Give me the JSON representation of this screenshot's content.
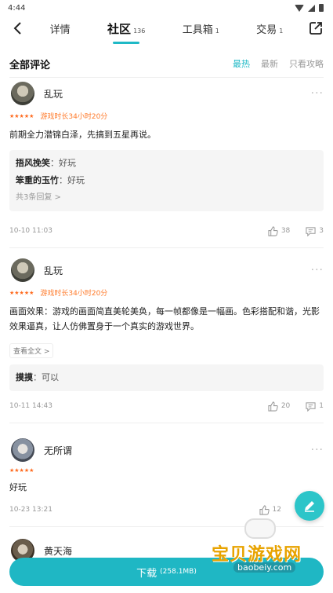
{
  "status_bar": {
    "time": "4:44"
  },
  "nav": {
    "tabs": [
      {
        "label": "详情",
        "count": ""
      },
      {
        "label": "社区",
        "count": "136"
      },
      {
        "label": "工具箱",
        "count": "1"
      },
      {
        "label": "交易",
        "count": "1"
      }
    ],
    "active_tab": "社区"
  },
  "section": {
    "title": "全部评论",
    "sorts": [
      "最热",
      "最新",
      "只看攻略"
    ],
    "active_sort": "最热"
  },
  "comments": [
    {
      "user": "乱玩",
      "stars": "★★★★★",
      "play_time": "游戏时长34小时20分",
      "text": "前期全力潜锦白泽，先搞到五星再说。",
      "replies": [
        {
          "name": "捂风挽笑",
          "text": "好玩"
        },
        {
          "name": "笨重的玉竹",
          "text": "好玩"
        }
      ],
      "reply_more": "共3条回复 >",
      "date": "10-10 11:03",
      "likes": "38",
      "reply_count": "3"
    },
    {
      "user": "乱玩",
      "stars": "★★★★★",
      "play_time": "游戏时长34小时20分",
      "text": "画面效果：游戏的画面简直美轮美奂，每一帧都像是一幅画。色彩搭配和谐，光影效果逼真，让人仿佛置身于一个真实的游戏世界。",
      "expand": "查看全文 >",
      "replies": [
        {
          "name": "摸摸",
          "text": "可以"
        }
      ],
      "date": "10-11 14:43",
      "likes": "20",
      "reply_count": "1"
    },
    {
      "user": "无所谓",
      "stars": "★★★★★",
      "text": "好玩",
      "date": "10-23 13:21",
      "likes": "12"
    },
    {
      "user": "黄天海"
    }
  ],
  "download": {
    "label": "下载",
    "size": "(258.1MB)"
  },
  "watermark": {
    "text": "宝贝游戏网",
    "url": "baobeiy.com"
  },
  "colors": {
    "accent": "#1fb9c6",
    "star": "#ff6a1e"
  }
}
